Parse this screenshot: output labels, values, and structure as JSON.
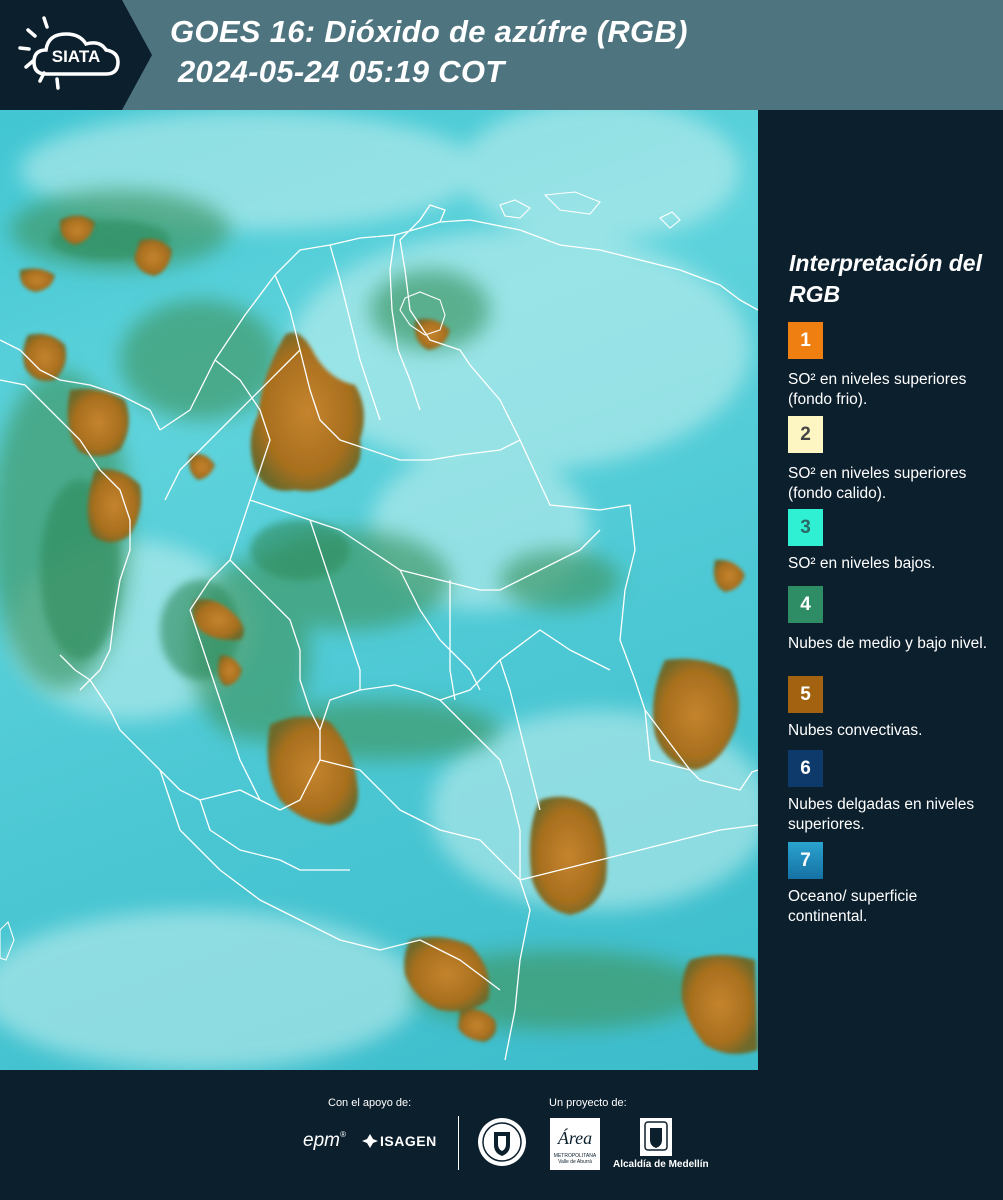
{
  "header": {
    "logo_text": "SIATA",
    "title_line1": "GOES 16: Dióxido de azúfre (RGB)",
    "title_line2": "2024-05-24 05:19 COT"
  },
  "map": {
    "region": "Colombia",
    "background_color": "#4ec8d4",
    "border_color": "#ffffff"
  },
  "legend": {
    "title": "Interpretación del RGB",
    "items": [
      {
        "number": "1",
        "color": "#f07f12",
        "number_color": "#ffffff",
        "label": "SO² en niveles superiores (fondo frio)."
      },
      {
        "number": "2",
        "color": "#fdf6c3",
        "number_color": "#444444",
        "label": "SO² en niveles superiores (fondo calido)."
      },
      {
        "number": "3",
        "color": "#2ff0d2",
        "number_color": "#2a6a66",
        "label": "SO² en niveles bajos."
      },
      {
        "number": "4",
        "color": "#2f8d66",
        "number_color": "#ffffff",
        "label": "Nubes de medio y bajo nivel."
      },
      {
        "number": "5",
        "color": "#a2620f",
        "number_color": "#ffffff",
        "label": "Nubes convectivas."
      },
      {
        "number": "6",
        "color": "#0d3a6a",
        "number_color": "#ffffff",
        "label": "Nubes delgadas en niveles superiores."
      },
      {
        "number": "7",
        "color": "#1e86b8",
        "number_color": "#ffffff",
        "label": "Oceano/ superficie continental."
      }
    ]
  },
  "footer": {
    "support_label": "Con el apoyo de:",
    "project_label": "Un proyecto de:",
    "sponsor_epm": "epm",
    "sponsor_isagen": "ISAGEN",
    "partner_area": "Área",
    "partner_area_sub": "METROPOLITANA",
    "partner_area_sub2": "Valle de Aburrá",
    "partner_alcaldia": "Alcaldía de Medellín"
  }
}
